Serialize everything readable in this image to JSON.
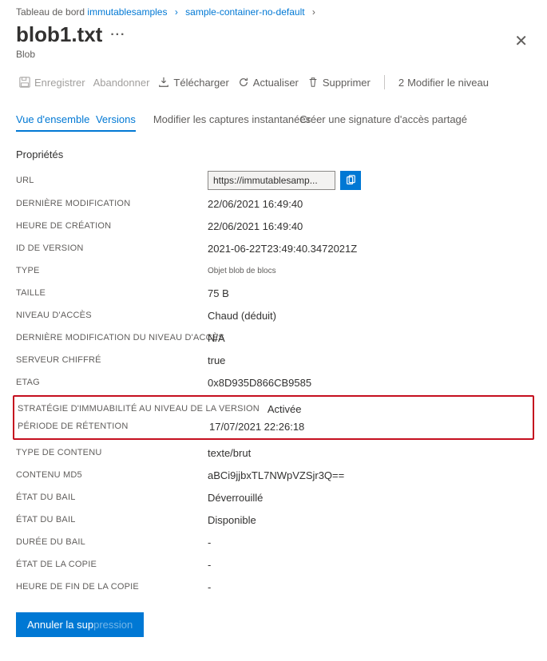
{
  "breadcrumb": {
    "root": "Tableau de bord",
    "items": [
      "immutablesamples",
      "sample-container-no-default"
    ]
  },
  "header": {
    "title": "blob1.txt",
    "subtitle": "Blob"
  },
  "toolbar": {
    "save": "Enregistrer",
    "discard": "Abandonner",
    "download": "Télécharger",
    "refresh": "Actualiser",
    "delete": "Supprimer",
    "change_tier": "Modifier le niveau",
    "tier_badge": "2"
  },
  "tabs": {
    "overview": "Vue d'ensemble",
    "versions": "Versions",
    "snapshots": "Modifier les captures instantanées",
    "sas": "Créer une signature d'accès partagé"
  },
  "section_title": "Propriétés",
  "props": {
    "url_label": "URL",
    "url_value": "https://immutablesamp...",
    "last_modified_label": "DERNIÈRE MODIFICATION",
    "last_modified_value": "22/06/2021 16:49:40",
    "creation_label": "HEURE DE CRÉATION",
    "creation_value": "22/06/2021 16:49:40",
    "version_id_label": "ID DE VERSION",
    "version_id_value": "2021-06-22T23:49:40.3472021Z",
    "type_label": "TYPE",
    "type_value": "Objet blob de blocs",
    "size_label": "TAILLE",
    "size_value": "75 B",
    "access_tier_label": "NIVEAU D'ACCÈS",
    "access_tier_value": "Chaud (déduit)",
    "access_tier_mod_label": "DERNIÈRE MODIFICATION DU NIVEAU D'ACCÈS",
    "access_tier_mod_value": "N/A",
    "server_encrypted_label": "SERVEUR CHIFFRÉ",
    "server_encrypted_value": "true",
    "etag_label": "ETAG",
    "etag_value": "0x8D935D866CB9585",
    "immutability_label": "STRATÉGIE D'IMMUABILITÉ AU NIVEAU DE LA VERSION",
    "immutability_value": "Activée",
    "retention_label": "PÉRIODE DE RÉTENTION",
    "retention_value": "17/07/2021 22:26:18",
    "content_type_label": "TYPE DE CONTENU",
    "content_type_value": "texte/brut",
    "md5_label": "CONTENU MD5",
    "md5_value": "aBCi9jjbxTL7NWpVZSjr3Q==",
    "lease_status_label": "ÉTAT DU BAIL",
    "lease_status_value": "Déverrouillé",
    "lease_state_label": "ÉTAT DU BAIL",
    "lease_state_value": "Disponible",
    "lease_duration_label": "DURÉE DU BAIL",
    "lease_duration_value": "-",
    "copy_status_label": "ÉTAT DE LA COPIE",
    "copy_status_value": "-",
    "copy_time_label": "HEURE DE FIN DE LA COPIE",
    "copy_time_value": "-"
  },
  "footer": {
    "undelete_prefix": "Annuler la sup",
    "undelete_suffix": "pression"
  }
}
